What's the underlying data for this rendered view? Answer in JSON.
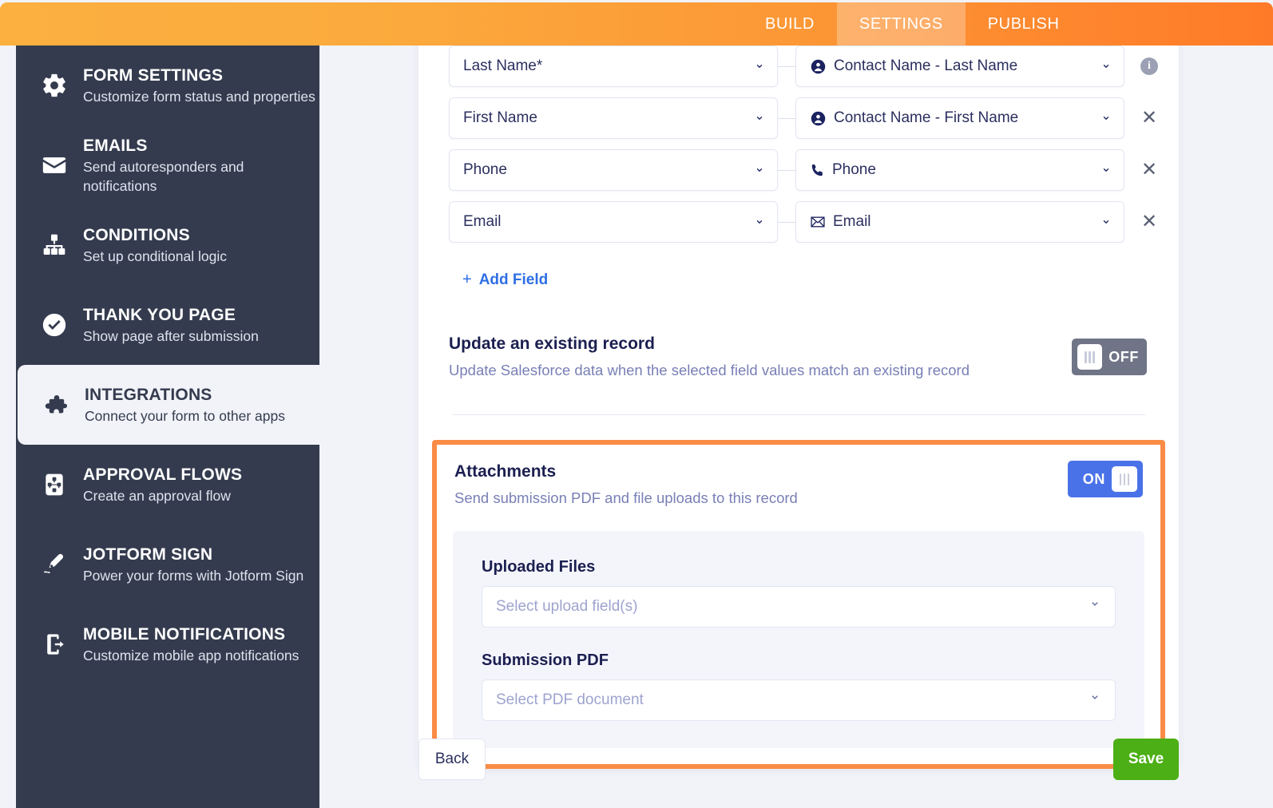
{
  "topbar": {
    "tabs": [
      {
        "label": "BUILD",
        "active": false
      },
      {
        "label": "SETTINGS",
        "active": true
      },
      {
        "label": "PUBLISH",
        "active": false
      }
    ]
  },
  "sidebar": {
    "items": [
      {
        "title": "FORM SETTINGS",
        "desc": "Customize form status and properties",
        "icon": "gear-icon",
        "active": false
      },
      {
        "title": "EMAILS",
        "desc": "Send autoresponders and notifications",
        "icon": "envelope-icon",
        "active": false
      },
      {
        "title": "CONDITIONS",
        "desc": "Set up conditional logic",
        "icon": "sitemap-icon",
        "active": false
      },
      {
        "title": "THANK YOU PAGE",
        "desc": "Show page after submission",
        "icon": "check-circle-icon",
        "active": false
      },
      {
        "title": "INTEGRATIONS",
        "desc": "Connect your form to other apps",
        "icon": "puzzle-icon",
        "active": true
      },
      {
        "title": "APPROVAL FLOWS",
        "desc": "Create an approval flow",
        "icon": "approval-flow-icon",
        "active": false
      },
      {
        "title": "JOTFORM SIGN",
        "desc": "Power your forms with Jotform Sign",
        "icon": "pen-nib-icon",
        "active": false
      },
      {
        "title": "MOBILE NOTIFICATIONS",
        "desc": "Customize mobile app notifications",
        "icon": "mobile-notification-icon",
        "active": false
      }
    ]
  },
  "field_mapping": {
    "rows": [
      {
        "form_field": "Last Name*",
        "target_field": "Contact Name - Last Name",
        "target_icon": "contact-person-icon",
        "row_action": "info"
      },
      {
        "form_field": "First Name",
        "target_field": "Contact Name - First Name",
        "target_icon": "contact-person-icon",
        "row_action": "remove"
      },
      {
        "form_field": "Phone",
        "target_field": "Phone",
        "target_icon": "phone-icon",
        "row_action": "remove"
      },
      {
        "form_field": "Email",
        "target_field": "Email",
        "target_icon": "envelope-icon",
        "row_action": "remove"
      }
    ],
    "add_field_label": "Add Field",
    "add_field_plus": "+"
  },
  "update_record": {
    "title": "Update an existing record",
    "desc": "Update Salesforce data when the selected field values match an existing record",
    "toggle_state": "OFF"
  },
  "attachments": {
    "title": "Attachments",
    "desc": "Send submission PDF and file uploads to this record",
    "toggle_state": "ON",
    "uploaded_files_label": "Uploaded Files",
    "uploaded_files_placeholder": "Select upload field(s)",
    "submission_pdf_label": "Submission PDF",
    "submission_pdf_placeholder": "Select PDF document"
  },
  "footer": {
    "back_label": "Back",
    "save_label": "Save"
  },
  "colors": {
    "topbar_start": "#fbb040",
    "topbar_end": "#ff7a28",
    "sidebar_bg": "#343b4e",
    "page_bg": "#f2f3f9",
    "highlight_orange": "#fa8c46",
    "toggle_on_blue": "#4a72e8",
    "toggle_off_gray": "#6f7486",
    "save_green": "#4caf15",
    "link_blue": "#2f6fe4",
    "heading_navy": "#1b1f50",
    "muted_purple": "#787fb5"
  }
}
